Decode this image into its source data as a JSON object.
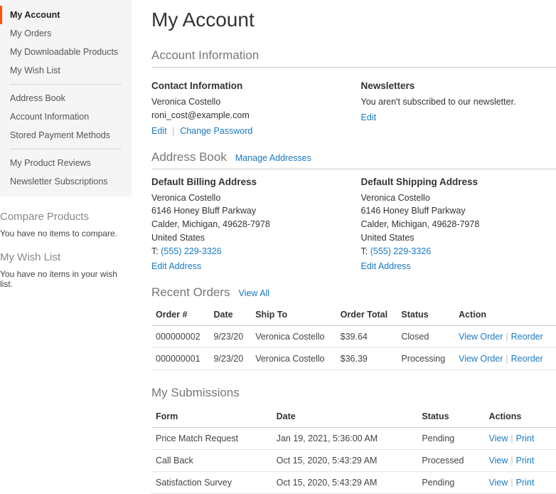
{
  "sidebar": {
    "nav": [
      {
        "label": "My Account",
        "active": true
      },
      {
        "label": "My Orders"
      },
      {
        "label": "My Downloadable Products"
      },
      {
        "label": "My Wish List"
      },
      {
        "divider": true
      },
      {
        "label": "Address Book"
      },
      {
        "label": "Account Information"
      },
      {
        "label": "Stored Payment Methods"
      },
      {
        "divider": true
      },
      {
        "label": "My Product Reviews"
      },
      {
        "label": "Newsletter Subscriptions"
      }
    ],
    "compare": {
      "title": "Compare Products",
      "empty": "You have no items to compare."
    },
    "wishlist": {
      "title": "My Wish List",
      "empty": "You have no items in your wish list."
    }
  },
  "page_title": "My Account",
  "account_info": {
    "heading": "Account Information",
    "contact": {
      "title": "Contact Information",
      "name": "Veronica Costello",
      "email": "roni_cost@example.com",
      "edit": "Edit",
      "change_pw": "Change Password"
    },
    "newsletter": {
      "title": "Newsletters",
      "text": "You aren't subscribed to our newsletter.",
      "edit": "Edit"
    }
  },
  "address_book": {
    "heading": "Address Book",
    "manage": "Manage Addresses",
    "billing": {
      "title": "Default Billing Address",
      "name": "Veronica Costello",
      "street": "6146 Honey Bluff Parkway",
      "city": "Calder, Michigan, 49628-7978",
      "country": "United States",
      "phone_label": "T: ",
      "phone": "(555) 229-3326",
      "edit": "Edit Address"
    },
    "shipping": {
      "title": "Default Shipping Address",
      "name": "Veronica Costello",
      "street": "6146 Honey Bluff Parkway",
      "city": "Calder, Michigan, 49628-7978",
      "country": "United States",
      "phone_label": "T: ",
      "phone": "(555) 229-3326",
      "edit": "Edit Address"
    }
  },
  "recent_orders": {
    "heading": "Recent Orders",
    "view_all": "View All",
    "columns": {
      "order": "Order #",
      "date": "Date",
      "shipto": "Ship To",
      "total": "Order Total",
      "status": "Status",
      "action": "Action"
    },
    "rows": [
      {
        "order": "000000002",
        "date": "9/23/20",
        "shipto": "Veronica Costello",
        "total": "$39.64",
        "status": "Closed",
        "view": "View Order",
        "reorder": "Reorder"
      },
      {
        "order": "000000001",
        "date": "9/23/20",
        "shipto": "Veronica Costello",
        "total": "$36.39",
        "status": "Processing",
        "view": "View Order",
        "reorder": "Reorder"
      }
    ]
  },
  "submissions": {
    "heading": "My Submissions",
    "columns": {
      "form": "Form",
      "date": "Date",
      "status": "Status",
      "actions": "Actions"
    },
    "rows": [
      {
        "form": "Price Match Request",
        "date": "Jan 19, 2021, 5:36:00 AM",
        "status": "Pending",
        "view": "View",
        "print": "Print"
      },
      {
        "form": "Call Back",
        "date": "Oct 15, 2020, 5:43:29 AM",
        "status": "Processed",
        "view": "View",
        "print": "Print"
      },
      {
        "form": "Satisfaction Survey",
        "date": "Oct 15, 2020, 5:43:29 AM",
        "status": "Pending",
        "view": "View",
        "print": "Print"
      }
    ]
  }
}
